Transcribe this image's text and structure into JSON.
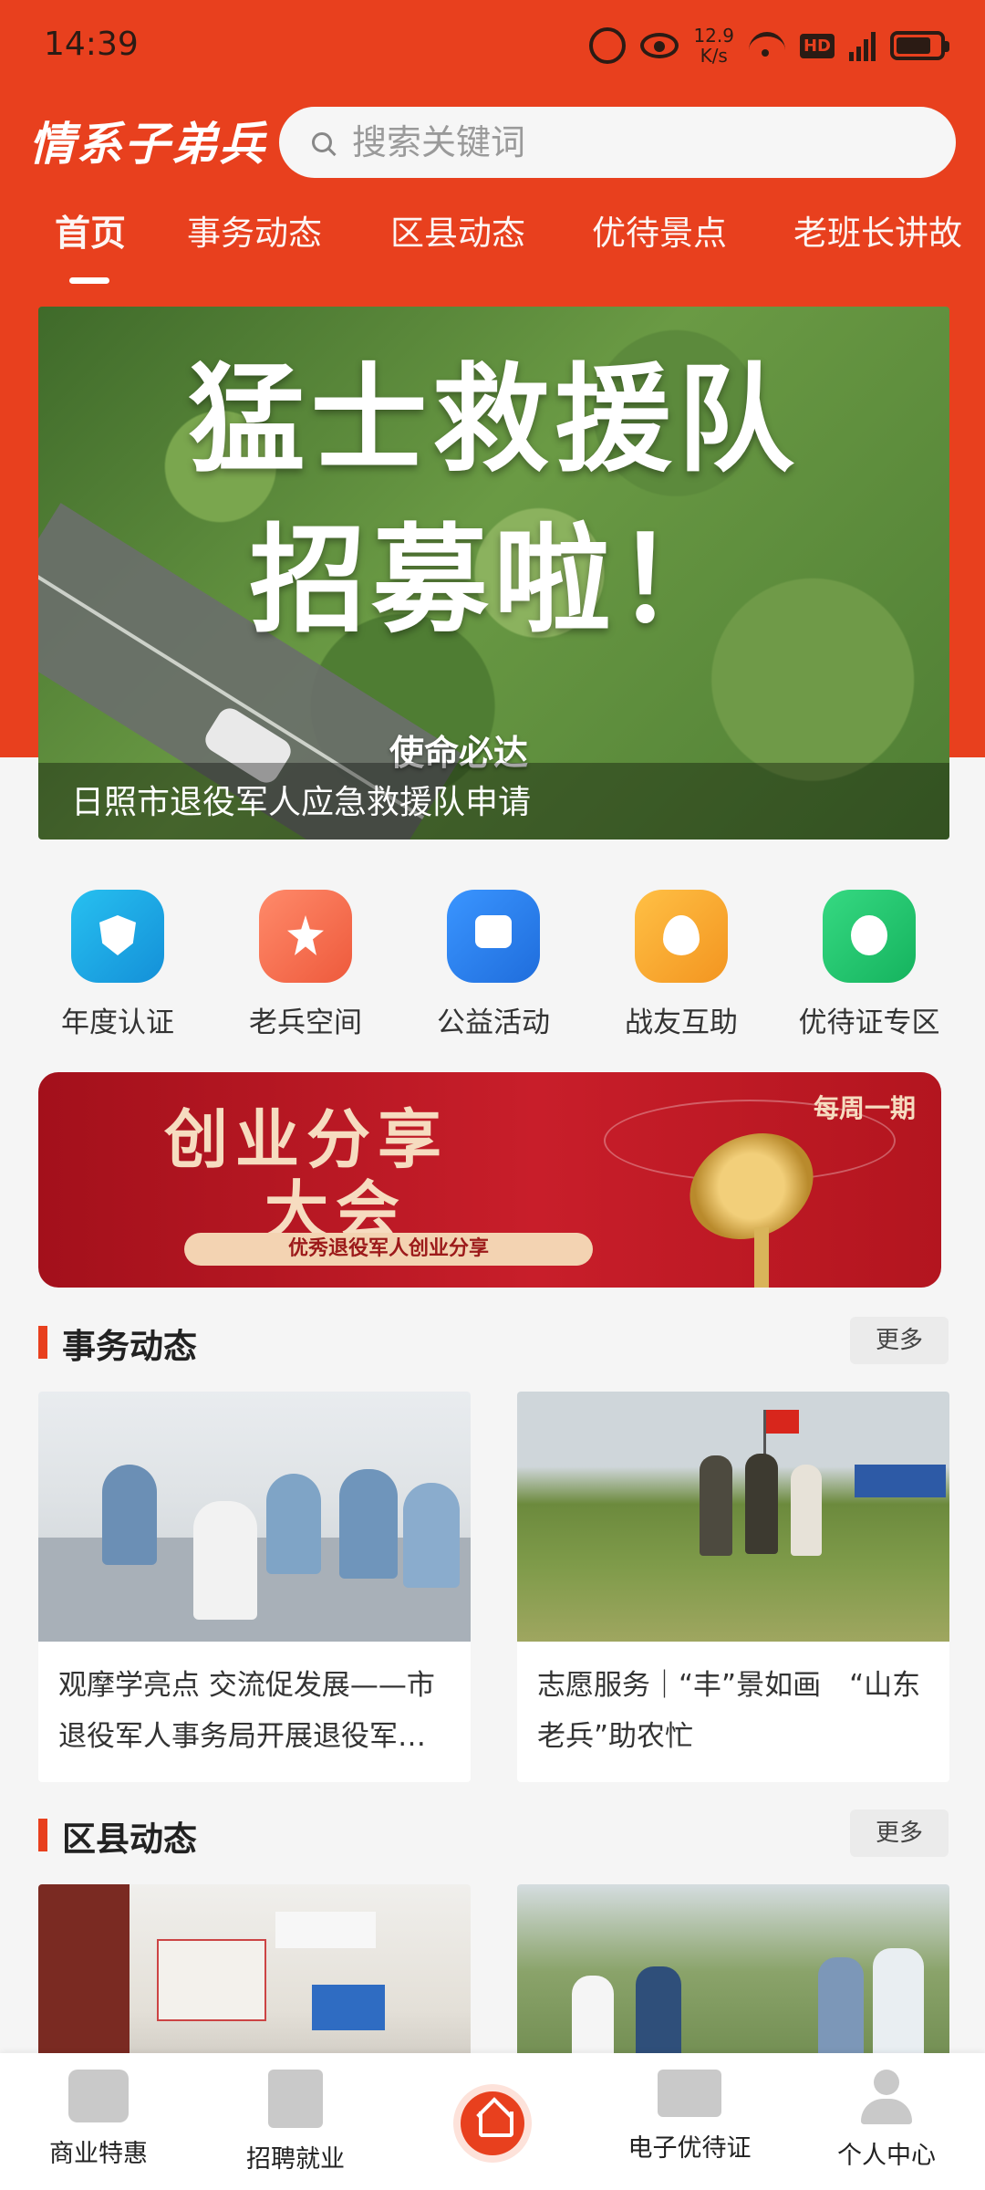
{
  "status_bar": {
    "time": "14:39",
    "net_speed_value": "12.9",
    "net_speed_unit": "K/s",
    "hd": "HD",
    "network": "4G"
  },
  "header": {
    "logo": "情系子弟兵",
    "search_placeholder": "搜索关键词"
  },
  "tabs": [
    {
      "label": "首页",
      "active": true
    },
    {
      "label": "事务动态",
      "active": false
    },
    {
      "label": "区县动态",
      "active": false
    },
    {
      "label": "优待景点",
      "active": false
    },
    {
      "label": "老班长讲故",
      "active": false
    }
  ],
  "banner": {
    "headline_line1": "猛士救援队",
    "headline_line2": "招募啦！",
    "slogan": "使命必达",
    "caption": "日照市退役军人应急救援队申请"
  },
  "quick_entries": [
    {
      "label": "年度认证",
      "icon": "shield-star-icon",
      "color": "#1aa6e0"
    },
    {
      "label": "老兵空间",
      "icon": "veteran-badge-icon",
      "color": "#f36a4a"
    },
    {
      "label": "公益活动",
      "icon": "chat-bubble-icon",
      "color": "#2b7de8"
    },
    {
      "label": "战友互助",
      "icon": "sprout-heart-icon",
      "color": "#f7a12b"
    },
    {
      "label": "优待证专区",
      "icon": "compass-icon",
      "color": "#21c16b"
    }
  ],
  "promo": {
    "title_line1": "创业分享",
    "title_line2": "大会",
    "subtitle": "优秀退役军人创业分享",
    "tag": "每周一期"
  },
  "sections": [
    {
      "title": "事务动态",
      "more": "更多",
      "cards": [
        {
          "text": "观摩学亮点 交流促发展——市退役军人事务局开展退役军…"
        },
        {
          "text": "志愿服务｜“丰”景如画　“山东老兵”助农忙"
        }
      ]
    },
    {
      "title": "区县动态",
      "more": "更多",
      "cards": [
        {
          "text": ""
        },
        {
          "text": ""
        }
      ]
    }
  ],
  "bottom_nav": [
    {
      "label": "商业特惠",
      "icon": "yen-ticket-icon"
    },
    {
      "label": "招聘就业",
      "icon": "briefcase-icon"
    },
    {
      "label": "",
      "icon": "home-icon"
    },
    {
      "label": "电子优待证",
      "icon": "id-card-icon"
    },
    {
      "label": "个人中心",
      "icon": "person-icon"
    }
  ],
  "colors": {
    "brand": "#e8401e",
    "background": "#f5f5f5"
  }
}
